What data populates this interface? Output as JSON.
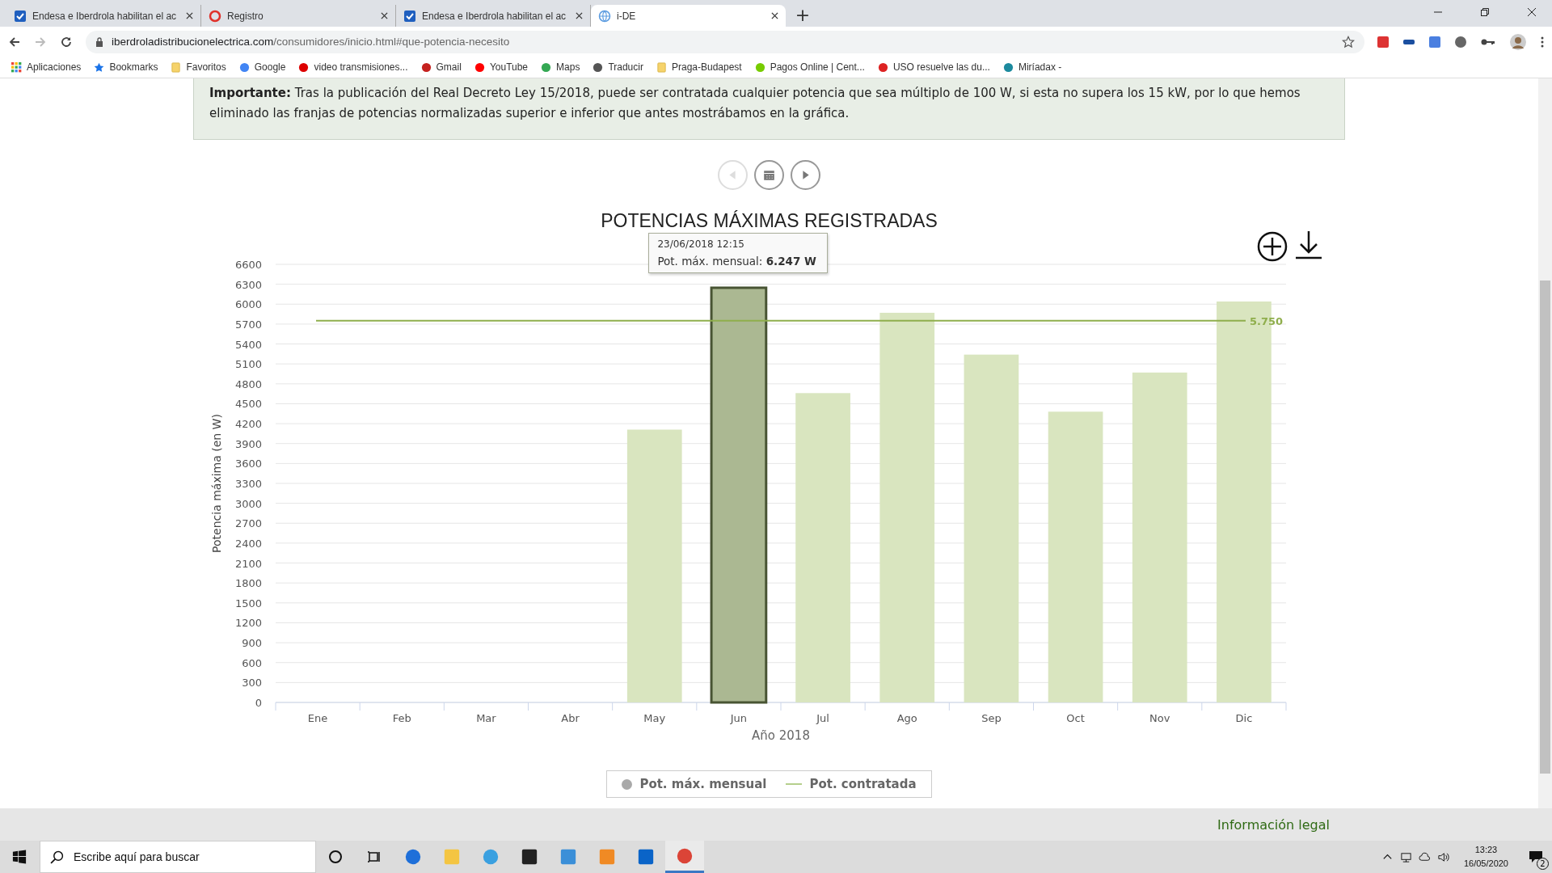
{
  "browser": {
    "tabs": [
      {
        "title": "Endesa e Iberdrola habilitan el ac",
        "selected": false
      },
      {
        "title": "Registro",
        "selected": false
      },
      {
        "title": "Endesa e Iberdrola habilitan el ac",
        "selected": false
      },
      {
        "title": "i-DE",
        "selected": true
      }
    ],
    "new_tab": "+",
    "url": {
      "domain": "iberdroladistribucionelectrica.com",
      "path": "/consumidores/inicio.html#que-potencia-necesito"
    },
    "bookmarks": [
      "Aplicaciones",
      "Bookmarks",
      "Favoritos",
      "Google",
      "video transmisiones...",
      "Gmail",
      "YouTube",
      "Maps",
      "Traducir",
      "Praga-Budapest",
      "Pagos Online | Cent...",
      "USO resuelve las du...",
      "Miríadax -"
    ]
  },
  "notice": {
    "text": "**Importante:** Tras la publicación del Real Decreto Ley 15/2018, puede ser contratada cualquier potencia que sea múltiplo de 100 W, si esta no supera los 15 kW, por lo que hemos eliminado las franjas de potencias normalizadas superior e inferior que antes mostrábamos en la gráfica."
  },
  "chart_nav": [
    {
      "kind": "prev",
      "disabled": true
    },
    {
      "kind": "calendar",
      "disabled": false
    },
    {
      "kind": "next",
      "disabled": false
    }
  ],
  "chart": {
    "tooltip": {
      "date": "23/06/2018 12:15",
      "text": "Pot. máx. mensual: **6.247 W**"
    },
    "bars": [
      {
        "selected": false
      },
      {
        "selected": false
      },
      {
        "selected": false
      },
      {
        "selected": false
      },
      {
        "selected": false
      },
      {
        "selected": true
      },
      {
        "selected": false
      },
      {
        "selected": false
      },
      {
        "selected": false
      },
      {
        "selected": false
      },
      {
        "selected": false
      },
      {
        "selected": false
      }
    ],
    "chart_data": {
      "type": "bar",
      "title": "POTENCIAS MÁXIMAS REGISTRADAS",
      "xlabel": "Año 2018",
      "ylabel": "Potencia máxima (en W)",
      "categories": [
        "Ene",
        "Feb",
        "Mar",
        "Abr",
        "May",
        "Jun",
        "Jul",
        "Ago",
        "Sep",
        "Oct",
        "Nov",
        "Dic"
      ],
      "series": [
        {
          "name": "Pot. máx. mensual",
          "color": "#d9e5bf",
          "values": [
            null,
            null,
            null,
            null,
            4110,
            6247,
            4660,
            5870,
            5240,
            4380,
            4970,
            6040
          ]
        },
        {
          "name": "Pot. contratada",
          "type": "line",
          "color": "#8fae4c",
          "values": [
            5750,
            5750,
            5750,
            5750,
            5750,
            5750,
            5750,
            5750,
            5750,
            5750,
            5750,
            5750
          ]
        }
      ],
      "ylim": [
        0,
        6600
      ],
      "yticks": [
        0,
        300,
        600,
        900,
        1200,
        1500,
        1800,
        2100,
        2400,
        2700,
        3000,
        3300,
        3600,
        3900,
        4200,
        4500,
        4800,
        5100,
        5400,
        5700,
        6000,
        6300,
        6600
      ],
      "grid": true
    },
    "line_label": "5.750",
    "legend": [
      {
        "kind": "dot",
        "color": "#a9a9a9"
      },
      {
        "kind": "line",
        "color": "#b5cf8c"
      }
    ]
  },
  "footer": {
    "link": "Información legal"
  },
  "taskbar": {
    "search_placeholder": "Escribe aquí para buscar",
    "time": "13:23",
    "date": "16/05/2020",
    "notifications": "2"
  }
}
